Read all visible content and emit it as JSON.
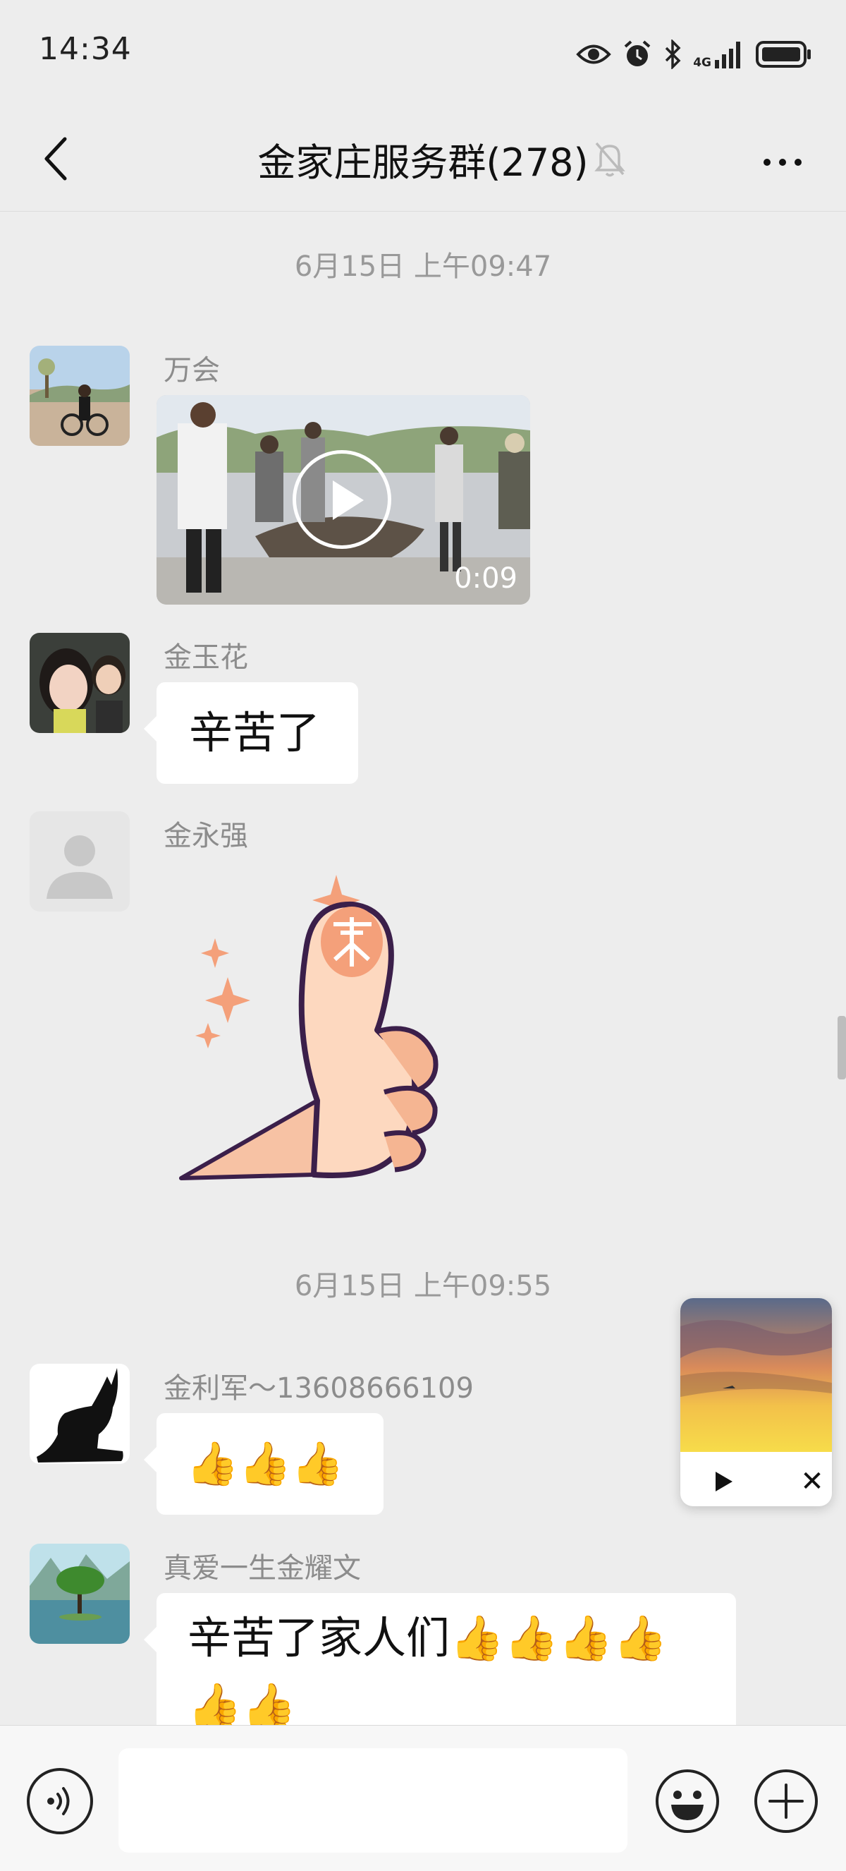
{
  "status_bar": {
    "time": "14:34",
    "network": "4G",
    "icons": [
      "eye-icon",
      "alarm-icon",
      "bluetooth-icon",
      "signal-icon",
      "battery-icon"
    ]
  },
  "header": {
    "title": "金家庄服务群(278)",
    "icons": [
      "back-arrow-icon",
      "mute-bell-icon",
      "more-dots-icon"
    ]
  },
  "chat": {
    "timestamps": [
      "6月15日 上午09:47",
      "6月15日 上午09:55"
    ],
    "messages": [
      {
        "sender": "万会",
        "type": "video",
        "duration": "0:09"
      },
      {
        "sender": "金玉花",
        "type": "text",
        "text": "辛苦了"
      },
      {
        "sender": "金永强",
        "type": "sticker",
        "sticker": "thumbs-up-sticker"
      },
      {
        "sender": "金利军～13608666109",
        "type": "text",
        "text": "👍👍👍"
      },
      {
        "sender": "真爱一生金耀文",
        "type": "text",
        "text_line1": "辛苦了家人们👍👍👍👍",
        "text_line2": "👍👍"
      }
    ]
  },
  "mini_player": {
    "icons": [
      "play-icon",
      "close-icon"
    ]
  },
  "input_bar": {
    "value": "",
    "icons": [
      "voice-icon",
      "emoji-icon",
      "plus-icon"
    ]
  },
  "colors": {
    "background": "#ededed",
    "bubble": "#ffffff",
    "meta_text": "#999999",
    "sticker_orange": "#f4a07a",
    "sticker_outline": "#3b1f4a"
  }
}
